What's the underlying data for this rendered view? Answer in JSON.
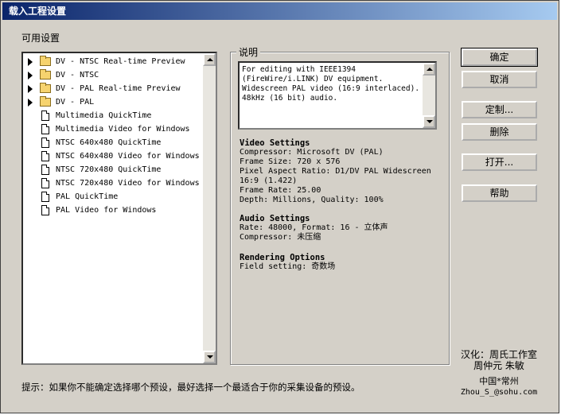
{
  "window": {
    "title": "载入工程设置"
  },
  "available_label": "可用设置",
  "presets": [
    {
      "label": "DV - NTSC Real-time Preview",
      "type": "folder"
    },
    {
      "label": "DV - NTSC",
      "type": "folder"
    },
    {
      "label": "DV - PAL Real-time Preview",
      "type": "folder"
    },
    {
      "label": "DV - PAL",
      "type": "folder"
    },
    {
      "label": "Multimedia QuickTime",
      "type": "file"
    },
    {
      "label": "Multimedia Video for Windows",
      "type": "file"
    },
    {
      "label": "NTSC 640x480 QuickTime",
      "type": "file"
    },
    {
      "label": "NTSC 640x480 Video for Windows",
      "type": "file"
    },
    {
      "label": "NTSC 720x480 QuickTime",
      "type": "file"
    },
    {
      "label": "NTSC 720x480 Video for Windows",
      "type": "file"
    },
    {
      "label": "PAL QuickTime",
      "type": "file"
    },
    {
      "label": "PAL Video for Windows",
      "type": "file"
    }
  ],
  "description": {
    "label": "说明",
    "text": "For editing with IEEE1394 (FireWire/i.LINK) DV equipment.\nWidescreen PAL video (16:9 interlaced).\n48kHz (16 bit) audio."
  },
  "video_settings": {
    "title": "Video Settings",
    "lines": [
      "Compressor: Microsoft DV (PAL)",
      "Frame Size: 720 x 576",
      "Pixel Aspect Ratio: D1/DV PAL Widescreen",
      "16:9 (1.422)",
      "Frame Rate: 25.00",
      "Depth: Millions, Quality: 100%"
    ]
  },
  "audio_settings": {
    "title": "Audio Settings",
    "lines": [
      "Rate: 48000, Format: 16 - 立体声",
      "Compressor: 未压缩"
    ]
  },
  "rendering_options": {
    "title": "Rendering Options",
    "lines": [
      "Field setting: 奇数场"
    ]
  },
  "buttons": {
    "ok": "确定",
    "cancel": "取消",
    "customize": "定制...",
    "delete": "删除",
    "open": "打开...",
    "help": "帮助"
  },
  "credits": {
    "line1": "汉化：周氏工作室",
    "line2": "周仲元 朱敏",
    "line3": "中国*常州",
    "line4": "Zhou_S_@sohu.com"
  },
  "tip": "提示：如果你不能确定选择哪个预设，最好选择一个最适合于你的采集设备的预设。"
}
